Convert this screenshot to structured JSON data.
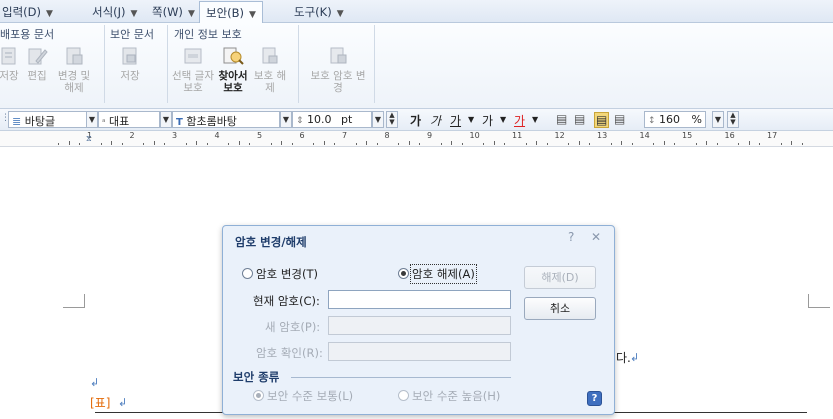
{
  "menu_tabs": [
    {
      "label": "입력(D)",
      "active": false
    },
    {
      "label": "서식(J)",
      "active": false
    },
    {
      "label": "쪽(W)",
      "active": false
    },
    {
      "label": "보안(B)",
      "active": true
    },
    {
      "label": "도구(K)",
      "active": false
    }
  ],
  "ribbon": {
    "groups": [
      {
        "title": "배포용 문서",
        "buttons": [
          {
            "label": "저장",
            "icon": "save-doc-icon",
            "enabled": false
          },
          {
            "label": "편집",
            "icon": "edit-doc-icon",
            "enabled": false
          },
          {
            "label": "변경 및 해제",
            "icon": "change-release-icon",
            "enabled": false
          }
        ]
      },
      {
        "title": "보안 문서",
        "buttons": [
          {
            "label": "저장",
            "icon": "secure-save-icon",
            "enabled": false
          }
        ]
      },
      {
        "title": "개인 정보 보호",
        "buttons": [
          {
            "label": "선택 글자 보호",
            "icon": "select-text-protect-icon",
            "enabled": false
          },
          {
            "label": "찾아서 보호",
            "icon": "find-protect-icon",
            "enabled": true
          },
          {
            "label": "보호 해제",
            "icon": "unprotect-icon",
            "enabled": false
          }
        ]
      },
      {
        "title": "",
        "buttons": [
          {
            "label": "보호 암호 변경",
            "icon": "protect-password-icon",
            "enabled": false
          }
        ]
      }
    ]
  },
  "format_toolbar": {
    "style": "바탕글",
    "language": "대표",
    "font": "함초롬바탕",
    "size": "10.0",
    "size_unit": "pt",
    "bold": "가",
    "italic": "가",
    "underline": "가",
    "strike": "가",
    "font_color": "가",
    "line_spacing": "160",
    "line_spacing_unit": "%"
  },
  "ruler": {
    "numbers": [
      "1",
      "2",
      "3",
      "4",
      "5",
      "6",
      "7",
      "8",
      "9",
      "10",
      "11",
      "12",
      "13",
      "14",
      "15",
      "16",
      "17"
    ]
  },
  "document": {
    "text_fragment": "다.",
    "table_tag": "[표]",
    "para_mark": "↲"
  },
  "dialog": {
    "title": "암호 변경/해제",
    "help_glyph": "?",
    "close_glyph": "✕",
    "radio_change": "암호 변경(T)",
    "radio_release": "암호 해제(A)",
    "selected": "release",
    "label_current": "현재 암호(C):",
    "label_new": "새 암호(P):",
    "label_confirm": "암호 확인(R):",
    "btn_release": "해제(D)",
    "btn_cancel": "취소",
    "section_title": "보안 종류",
    "radio_level_normal": "보안 수준 보통(L)",
    "radio_level_high": "보안 수준 높음(H)",
    "help_button_glyph": "?"
  },
  "colors": {
    "accent": "#3f6fbf",
    "table_tag": "#e46b0a",
    "dialog_bg": "#eaf1fa"
  }
}
